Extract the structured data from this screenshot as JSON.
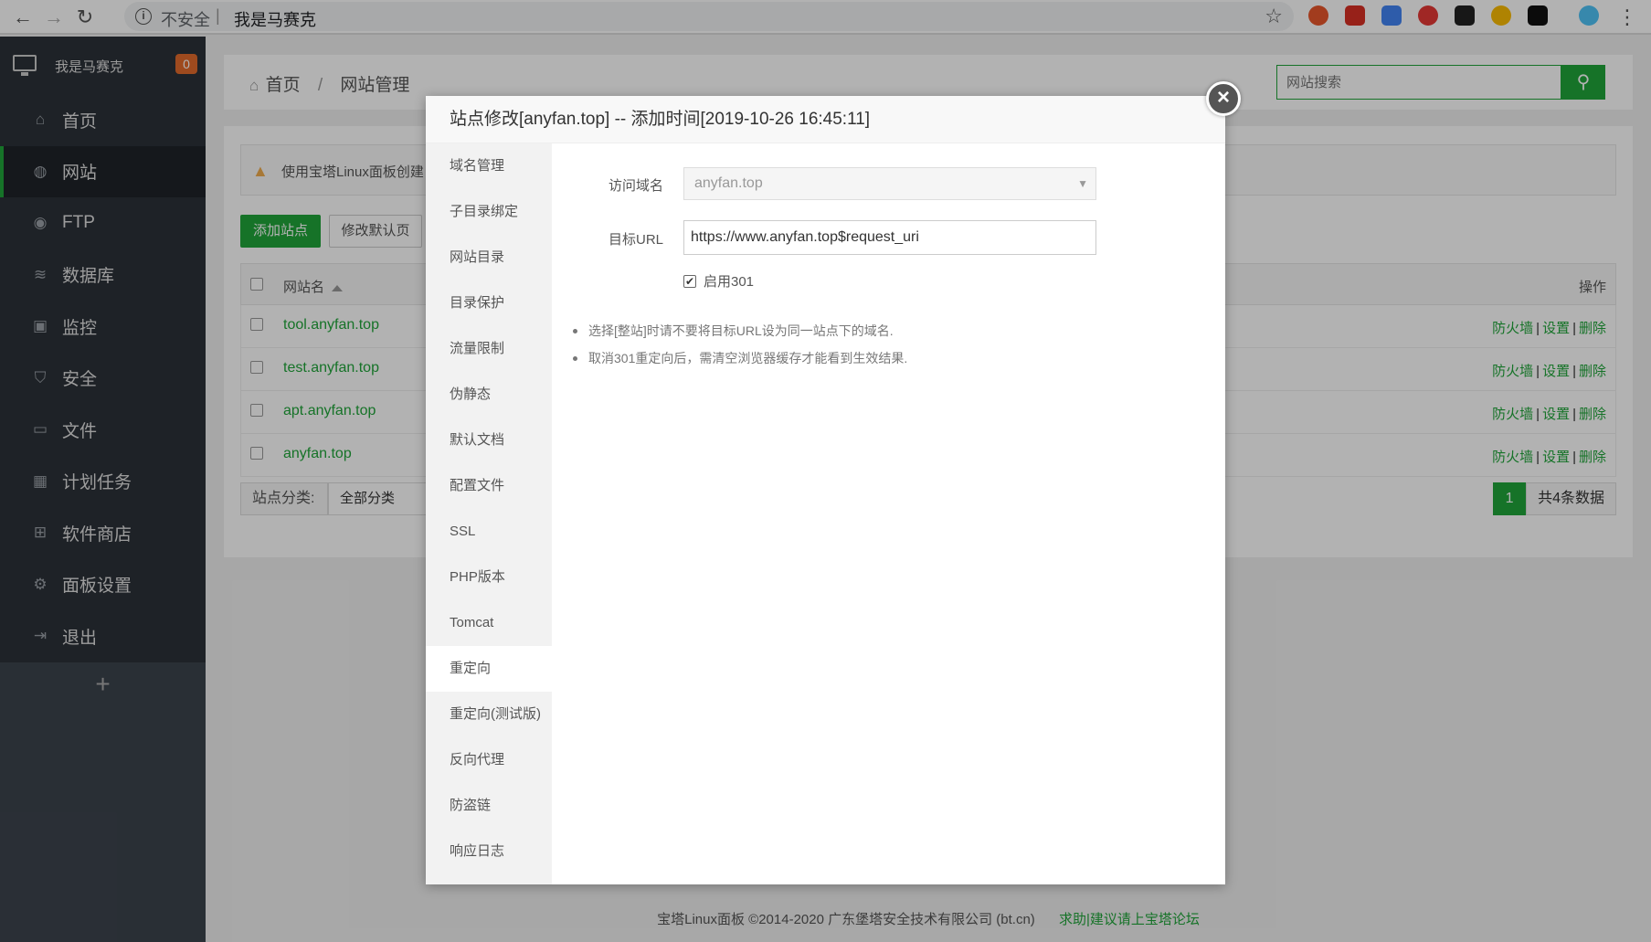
{
  "browser": {
    "security_label": "不安全",
    "separator": "|",
    "address": "我是马赛克"
  },
  "sidebar": {
    "title": "我是马赛克",
    "badge": "0",
    "items": [
      {
        "label": "首页",
        "icon": "home-icon"
      },
      {
        "label": "网站",
        "icon": "globe-icon"
      },
      {
        "label": "FTP",
        "icon": "ftp-icon"
      },
      {
        "label": "数据库",
        "icon": "database-icon"
      },
      {
        "label": "监控",
        "icon": "monitor-icon"
      },
      {
        "label": "安全",
        "icon": "shield-icon"
      },
      {
        "label": "文件",
        "icon": "folder-icon"
      },
      {
        "label": "计划任务",
        "icon": "calendar-icon"
      },
      {
        "label": "软件商店",
        "icon": "grid-icon"
      },
      {
        "label": "面板设置",
        "icon": "gear-icon"
      },
      {
        "label": "退出",
        "icon": "logout-icon"
      }
    ],
    "add": "+"
  },
  "breadcrumb": {
    "home": "首页",
    "sep": "/",
    "current": "网站管理"
  },
  "search": {
    "placeholder": "网站搜索"
  },
  "notice": {
    "text": "使用宝塔Linux面板创建"
  },
  "buttons": {
    "add_site": "添加站点",
    "edit_default": "修改默认页"
  },
  "table": {
    "col_name": "网站名",
    "col_op": "操作",
    "rows": [
      {
        "name": "tool.anyfan.top"
      },
      {
        "name": "test.anyfan.top"
      },
      {
        "name": "apt.anyfan.top"
      },
      {
        "name": "anyfan.top"
      }
    ],
    "ops": {
      "firewall": "防火墙",
      "settings": "设置",
      "delete": "删除",
      "bar": "|"
    }
  },
  "category": {
    "label": "站点分类:",
    "value": "全部分类"
  },
  "pager": {
    "page": "1",
    "total": "共4条数据"
  },
  "footer": {
    "copyright": "宝塔Linux面板 ©2014-2020 广东堡塔安全技术有限公司 (bt.cn)",
    "link": "求助|建议请上宝塔论坛"
  },
  "modal": {
    "title": "站点修改[anyfan.top] -- 添加时间[2019-10-26 16:45:11]",
    "close": "×",
    "nav": [
      "域名管理",
      "子目录绑定",
      "网站目录",
      "目录保护",
      "流量限制",
      "伪静态",
      "默认文档",
      "配置文件",
      "SSL",
      "PHP版本",
      "Tomcat",
      "重定向",
      "重定向(测试版)",
      "反向代理",
      "防盗链",
      "响应日志"
    ],
    "active_nav": "重定向",
    "form": {
      "domain_label": "访问域名",
      "domain_value": "anyfan.top",
      "url_label": "目标URL",
      "url_value": "https://www.anyfan.top$request_uri",
      "enable301": "启用301",
      "enable301_checked": true
    },
    "tips": [
      "选择[整站]时请不要将目标URL设为同一站点下的域名.",
      "取消301重定向后，需清空浏览器缓存才能看到生效结果."
    ]
  },
  "colors": {
    "brand": "#20a53a",
    "sidebar": "#3c444d"
  }
}
